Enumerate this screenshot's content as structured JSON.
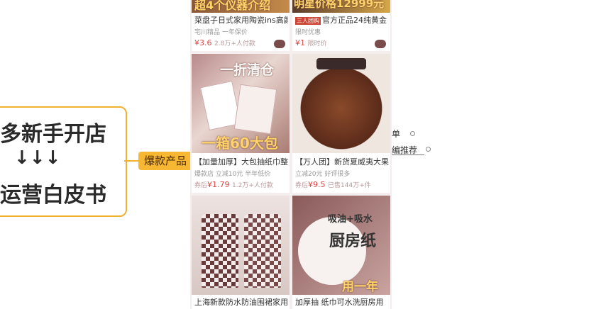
{
  "mindmap": {
    "center_line1": "多新手开店",
    "center_arrows": "↓↓↓",
    "center_line2": "运营白皮书",
    "branch_label": "爆款产品",
    "right_items": [
      "单",
      "编推荐"
    ]
  },
  "feed": {
    "cards": [
      {
        "banner": "超4个仪器介绍",
        "title": "菜盘子日式家用陶瓷ins高颜",
        "sub": "宅川精品 一年保价",
        "price": "¥3.6",
        "price_note": "2.8万+人付款"
      },
      {
        "banner": "明星价格12999元",
        "tag": "三人团购",
        "title": "官方正品24纯黄金",
        "sub": "限时优惠",
        "price": "¥1",
        "price_note": "限时价"
      },
      {
        "overlay_top": "一折清仓",
        "overlay_bottom": "一箱60大包",
        "title": "【加量加厚】大包抽纸巾整",
        "sub": "爆款店 立减10元 半年低价",
        "price_prefix": "券后",
        "price": "¥1.79",
        "price_note": "1.2万+人付款"
      },
      {
        "title": "【万人团】新货夏威夷大果",
        "sub": "立减20元 好评很多",
        "price_prefix": "券后",
        "price": "¥9.5",
        "price_note": "已售144万+件"
      },
      {
        "title": "上海新款防水防油围裙家用",
        "sub": "",
        "price": ""
      },
      {
        "overlay_top": "吸油+吸水",
        "overlay_mid": "厨房纸",
        "overlay_bottom": "用一年",
        "title": "加厚抽 纸巾可水洗厨房用",
        "sub": "",
        "price": ""
      }
    ]
  }
}
